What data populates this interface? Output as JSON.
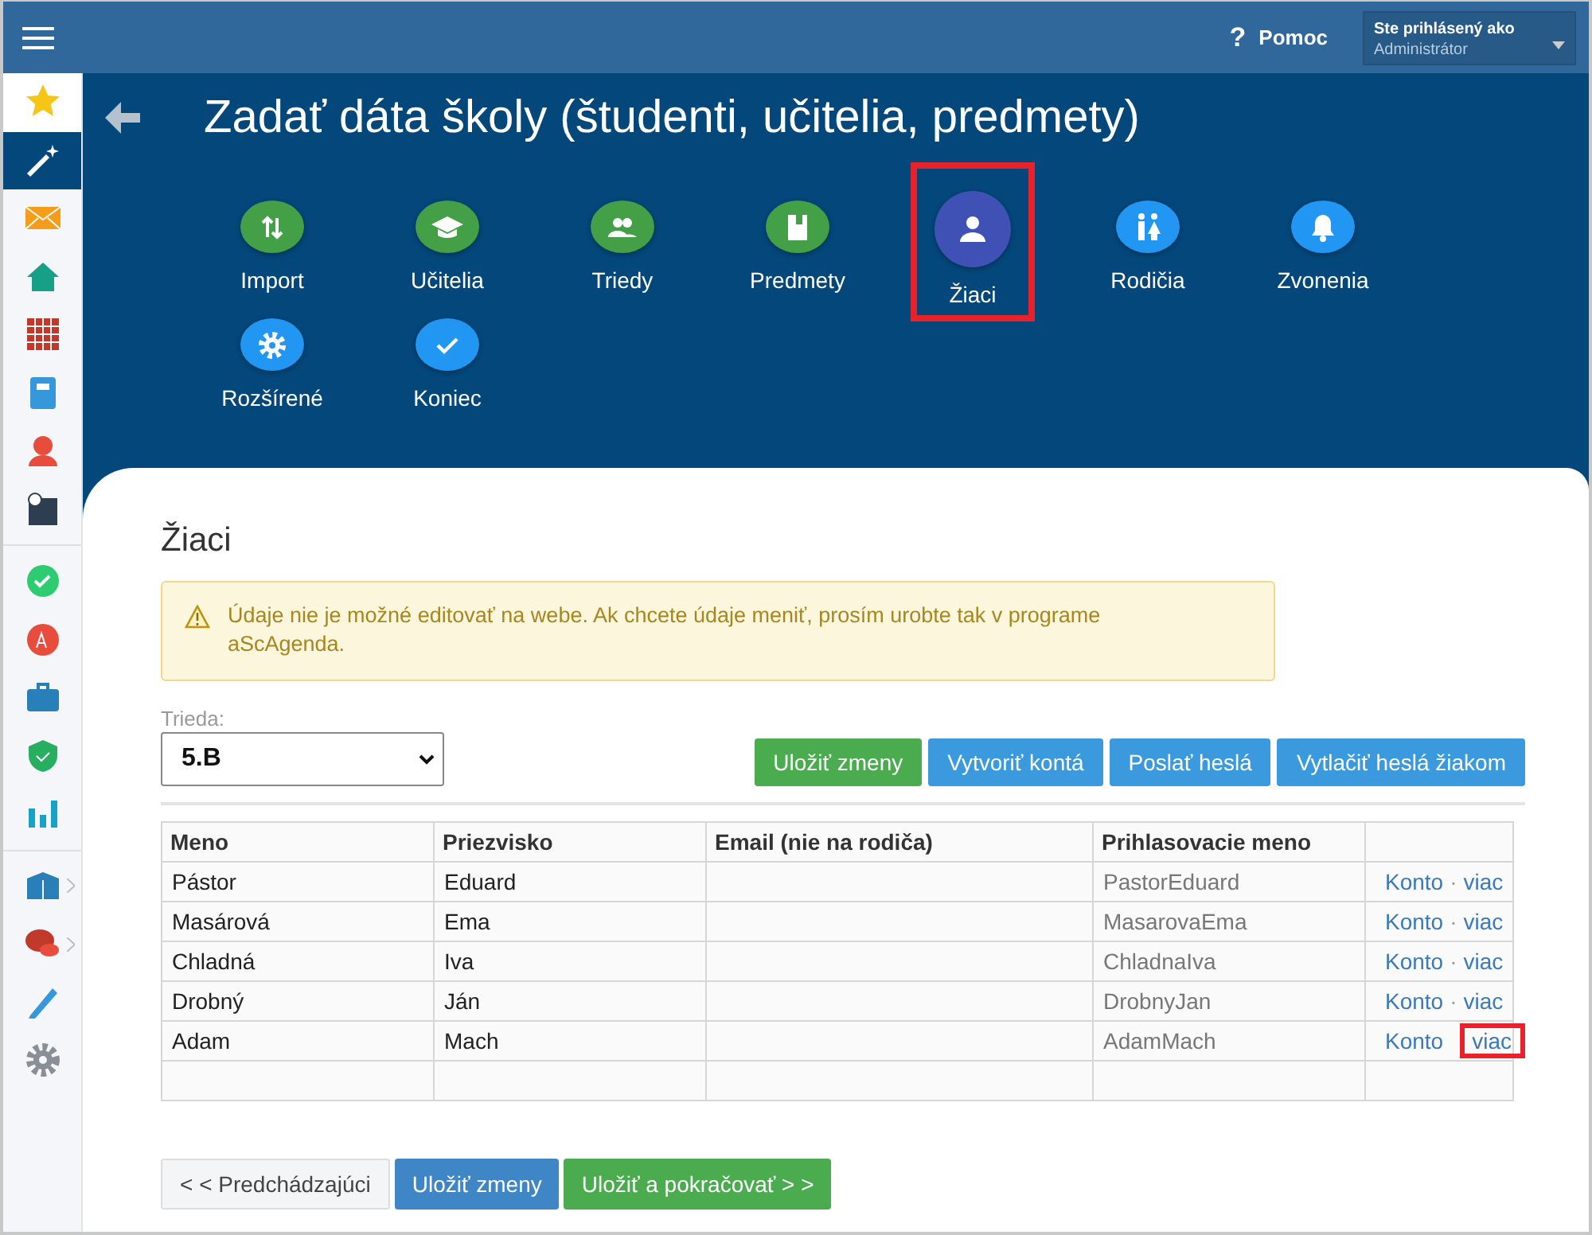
{
  "topbar": {
    "help_icon": "?",
    "help": "Pomoc",
    "user_label": "Ste prihlásený ako",
    "user_name": "Administrátor"
  },
  "sidebar": {
    "items": [
      {
        "selected": false,
        "has_submenu": false
      },
      {
        "selected": true,
        "has_submenu": false
      },
      {
        "selected": false,
        "has_submenu": false
      },
      {
        "selected": false,
        "has_submenu": false
      },
      {
        "selected": false,
        "has_submenu": false
      },
      {
        "selected": false,
        "has_submenu": false
      },
      {
        "selected": false,
        "has_submenu": false
      },
      {
        "selected": false,
        "has_submenu": false
      },
      {
        "selected": false,
        "has_submenu": false
      },
      {
        "selected": false,
        "has_submenu": false
      },
      {
        "selected": false,
        "has_submenu": false
      },
      {
        "selected": false,
        "has_submenu": false
      },
      {
        "selected": false,
        "has_submenu": false
      },
      {
        "selected": false,
        "has_submenu": true
      },
      {
        "selected": false,
        "has_submenu": true
      },
      {
        "selected": false,
        "has_submenu": false
      },
      {
        "selected": false,
        "has_submenu": false
      }
    ]
  },
  "page_title": "Zadať dáta školy (študenti, učitelia, predmety)",
  "steps": [
    {
      "label": "Import",
      "kind": "done",
      "selected": false,
      "highlighted": false
    },
    {
      "label": "Učitelia",
      "kind": "done",
      "selected": false,
      "highlighted": false
    },
    {
      "label": "Triedy",
      "kind": "done",
      "selected": false,
      "highlighted": false
    },
    {
      "label": "Predmety",
      "kind": "done",
      "selected": false,
      "highlighted": false
    },
    {
      "label": "Žiaci",
      "kind": "current",
      "selected": true,
      "highlighted": true
    },
    {
      "label": "Rodičia",
      "kind": "todo",
      "selected": false,
      "highlighted": false
    },
    {
      "label": "Zvonenia",
      "kind": "todo",
      "selected": false,
      "highlighted": false
    },
    {
      "label": "Rozšírené",
      "kind": "todo",
      "selected": false,
      "highlighted": false
    },
    {
      "label": "Koniec",
      "kind": "todo",
      "selected": false,
      "highlighted": false
    }
  ],
  "section_title": "Žiaci",
  "alert": "Údaje nie je možné editovať na webe. Ak chcete údaje meniť, prosím urobte tak v programe aScAgenda.",
  "class_field": {
    "label": "Trieda:",
    "value": "5.B"
  },
  "actions": [
    {
      "label": "Uložiť zmeny",
      "kind": "success"
    },
    {
      "label": "Vytvoriť kontá",
      "kind": "info"
    },
    {
      "label": "Poslať heslá",
      "kind": "info"
    },
    {
      "label": "Vytlačiť heslá žiakom",
      "kind": "info"
    }
  ],
  "table": {
    "columns": [
      "Meno",
      "Priezvisko",
      "Email (nie na rodiča)",
      "Prihlasovacie meno"
    ],
    "rows": [
      {
        "cells": [
          "Pástor",
          "Eduard",
          "",
          "PastorEduard"
        ],
        "links": [
          "Konto",
          "viac"
        ],
        "separator": "·",
        "highlighted": false
      },
      {
        "cells": [
          "Masárová",
          "Ema",
          "",
          "MasarovaEma"
        ],
        "links": [
          "Konto",
          "viac"
        ],
        "separator": "·",
        "highlighted": false
      },
      {
        "cells": [
          "Chladná",
          "Iva",
          "",
          "ChladnaIva"
        ],
        "links": [
          "Konto",
          "viac"
        ],
        "separator": "·",
        "highlighted": false
      },
      {
        "cells": [
          "Drobný",
          "Ján",
          "",
          "DrobnyJan"
        ],
        "links": [
          "Konto",
          "viac"
        ],
        "separator": "·",
        "highlighted": false
      },
      {
        "cells": [
          "Adam",
          "Mach",
          "",
          "AdamMach"
        ],
        "links": [
          "Konto",
          "viac"
        ],
        "highlighted": true
      }
    ]
  },
  "footer_buttons": [
    {
      "label": "< < Predchádzajúci",
      "kind": "default"
    },
    {
      "label": "Uložiť zmeny",
      "kind": "primary"
    },
    {
      "label": "Uložiť a pokračovať > >",
      "kind": "success"
    }
  ]
}
